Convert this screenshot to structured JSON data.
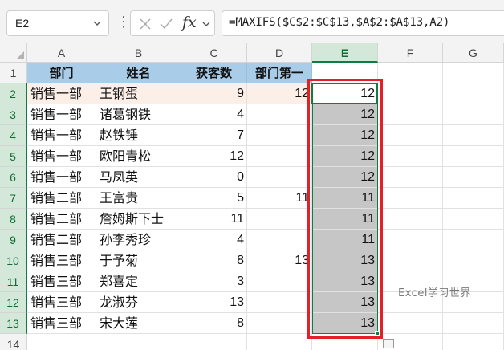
{
  "formula_bar": {
    "name_box": "E2",
    "function_symbol": "fx",
    "formula": "=MAXIFS($C$2:$C$13,$A$2:$A$13,A2)"
  },
  "sheet": {
    "columns": [
      "A",
      "B",
      "C",
      "D",
      "E",
      "F",
      "G"
    ],
    "selected_column": "E",
    "header_row": {
      "row": "1",
      "dept": "部门",
      "name": "姓名",
      "count": "获客数",
      "first": "部门第一",
      "e": ""
    },
    "rows": [
      {
        "row": "2",
        "dept": "销售一部",
        "name": "王钢蛋",
        "count": "9",
        "first": "12",
        "e": "12"
      },
      {
        "row": "3",
        "dept": "销售一部",
        "name": "诸葛钢铁",
        "count": "4",
        "first": "",
        "e": "12"
      },
      {
        "row": "4",
        "dept": "销售一部",
        "name": "赵铁锤",
        "count": "7",
        "first": "",
        "e": "12"
      },
      {
        "row": "5",
        "dept": "销售一部",
        "name": "欧阳青松",
        "count": "12",
        "first": "",
        "e": "12"
      },
      {
        "row": "6",
        "dept": "销售一部",
        "name": "马凤英",
        "count": "0",
        "first": "",
        "e": "12"
      },
      {
        "row": "7",
        "dept": "销售二部",
        "name": "王富贵",
        "count": "5",
        "first": "11",
        "e": "11"
      },
      {
        "row": "8",
        "dept": "销售二部",
        "name": "詹姆斯下士",
        "count": "11",
        "first": "",
        "e": "11"
      },
      {
        "row": "9",
        "dept": "销售二部",
        "name": "孙李秀珍",
        "count": "4",
        "first": "",
        "e": "11"
      },
      {
        "row": "10",
        "dept": "销售三部",
        "name": "于予菊",
        "count": "8",
        "first": "13",
        "e": "13"
      },
      {
        "row": "11",
        "dept": "销售三部",
        "name": "郑喜定",
        "count": "3",
        "first": "",
        "e": "13"
      },
      {
        "row": "12",
        "dept": "销售三部",
        "name": "龙淑芬",
        "count": "13",
        "first": "",
        "e": "13"
      },
      {
        "row": "13",
        "dept": "销售三部",
        "name": "宋大莲",
        "count": "8",
        "first": "",
        "e": "13"
      }
    ],
    "extra_row": "14"
  },
  "watermark": "Excel学习世界",
  "colors": {
    "header_fill": "#a9cce8",
    "row2_fill": "#fcefe8",
    "selection_fill": "#c6c6c6",
    "excel_green": "#107c41",
    "highlight_red": "#e32028"
  }
}
